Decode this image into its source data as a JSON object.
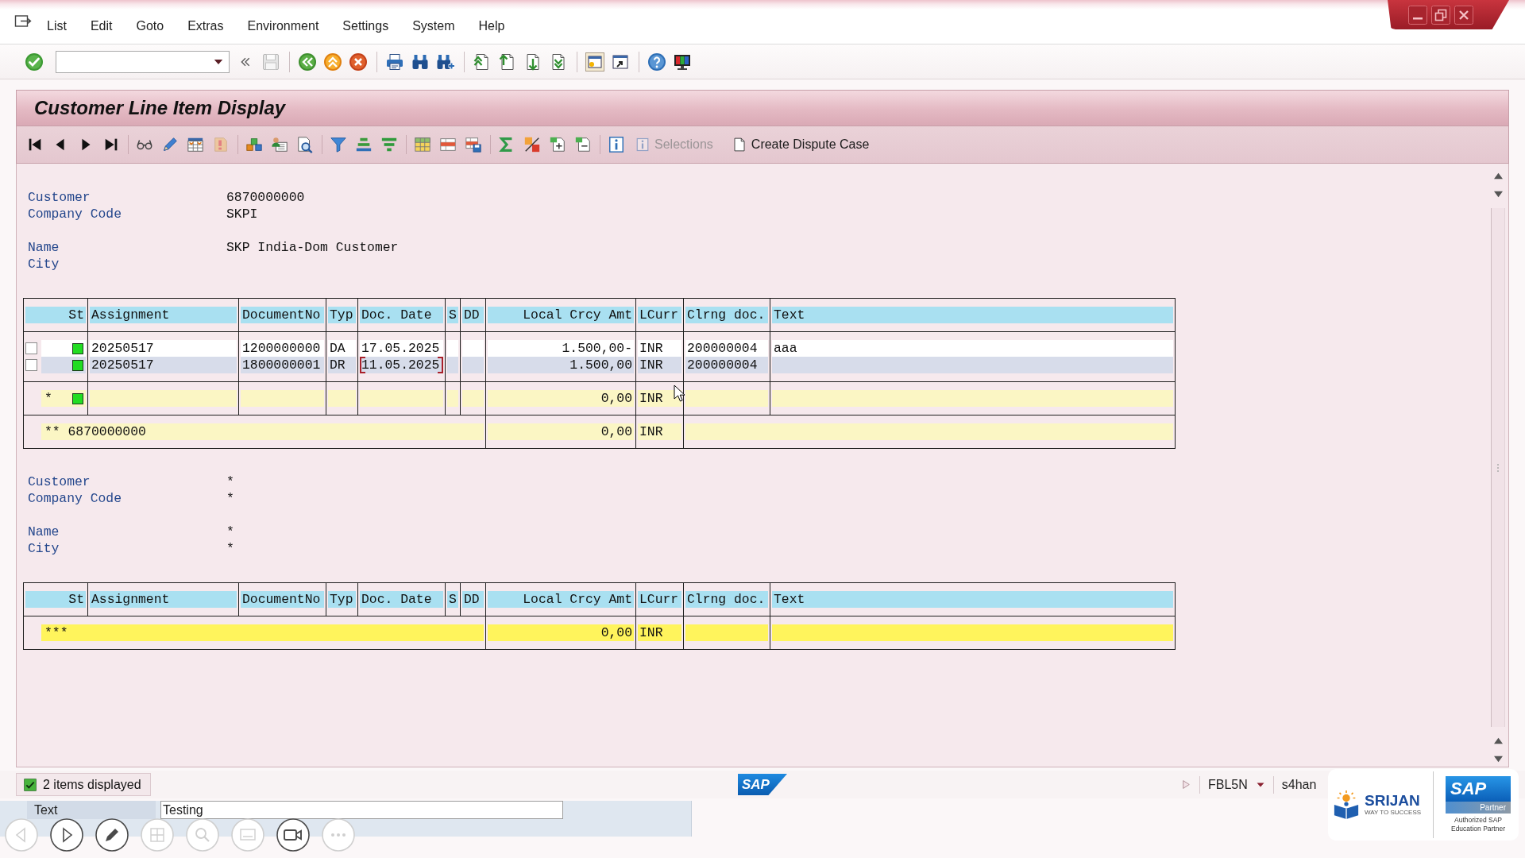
{
  "menu_bar": {
    "items": [
      "List",
      "Edit",
      "Goto",
      "Extras",
      "Environment",
      "Settings",
      "System",
      "Help"
    ]
  },
  "title": "Customer Line Item Display",
  "app_toolbar": {
    "buttons": [
      {
        "label": "Selections",
        "disabled": true
      },
      {
        "label": "Create Dispute Case",
        "disabled": false
      }
    ]
  },
  "sections": [
    {
      "field_groups": [
        [
          {
            "label": "Customer",
            "value": "6870000000"
          },
          {
            "label": "Company Code",
            "value": "SKPI"
          }
        ],
        [
          {
            "label": "Name",
            "value": "SKP India-Dom Customer"
          },
          {
            "label": "City"
          }
        ]
      ],
      "table": {
        "columns": [
          "St",
          "Assignment",
          "DocumentNo",
          "Typ",
          "Doc. Date",
          "S",
          "DD",
          "Local Crcy Amt",
          "LCurr",
          "Clrng doc.",
          "Text"
        ],
        "rows": [
          {
            "kind": "item",
            "checked": false,
            "cleared": true,
            "cursor": false,
            "cells": {
              "assignment": "20250517",
              "document_no": "1200000000",
              "typ": "DA",
              "doc_date": "17.05.2025",
              "local_crcy_amt": "1.500,00-",
              "lcurr": "INR",
              "clrng_doc": "200000004",
              "text": "aaa"
            }
          },
          {
            "kind": "item",
            "checked": false,
            "cleared": true,
            "cursor": true,
            "cells": {
              "assignment": "20250517",
              "document_no": "1800000001",
              "typ": "DR",
              "doc_date": "11.05.2025",
              "local_crcy_amt": "1.500,00",
              "lcurr": "INR",
              "clrng_doc": "200000004"
            }
          },
          {
            "kind": "subtotal",
            "marker": "*",
            "cleared": true,
            "cells": {
              "local_crcy_amt": "0,00",
              "lcurr": "INR"
            }
          },
          {
            "kind": "total",
            "marker": "** 6870000000",
            "cells": {
              "local_crcy_amt": "0,00",
              "lcurr": "INR"
            }
          }
        ]
      }
    },
    {
      "field_groups": [
        [
          {
            "label": "Customer",
            "value": "*"
          },
          {
            "label": "Company Code",
            "value": "*"
          }
        ],
        [
          {
            "label": "Name",
            "value": "*"
          },
          {
            "label": "City",
            "value": "*"
          }
        ]
      ],
      "table": {
        "columns": [
          "St",
          "Assignment",
          "DocumentNo",
          "Typ",
          "Doc. Date",
          "S",
          "DD",
          "Local Crcy Amt",
          "LCurr",
          "Clrng doc.",
          "Text"
        ],
        "rows": [
          {
            "kind": "grand_total",
            "marker": "***",
            "cells": {
              "local_crcy_amt": "0,00",
              "lcurr": "INR"
            }
          }
        ]
      }
    }
  ],
  "status_bar": {
    "message": {
      "success": true,
      "text": "2 items displayed"
    },
    "logo": "SAP",
    "transaction": "FBL5N",
    "system": "s4han"
  },
  "text_panel": {
    "label": "Text",
    "value": "Testing"
  },
  "player_controls": [
    {
      "kind": "back",
      "disabled": true
    },
    {
      "kind": "play",
      "disabled": false
    },
    {
      "kind": "pen",
      "disabled": false
    },
    {
      "kind": "layout",
      "disabled": true
    },
    {
      "kind": "zoom",
      "disabled": true
    },
    {
      "kind": "screen",
      "disabled": true
    },
    {
      "kind": "camera",
      "disabled": false
    },
    {
      "kind": "more",
      "disabled": true
    }
  ],
  "branding": {
    "school": {
      "name": "SRIJAN",
      "tagline": "WAY TO SUCCESS"
    },
    "partner": {
      "logo": "SAP",
      "badge": "Partner",
      "caption": [
        "Authorized SAP",
        "Education Partner"
      ]
    }
  }
}
